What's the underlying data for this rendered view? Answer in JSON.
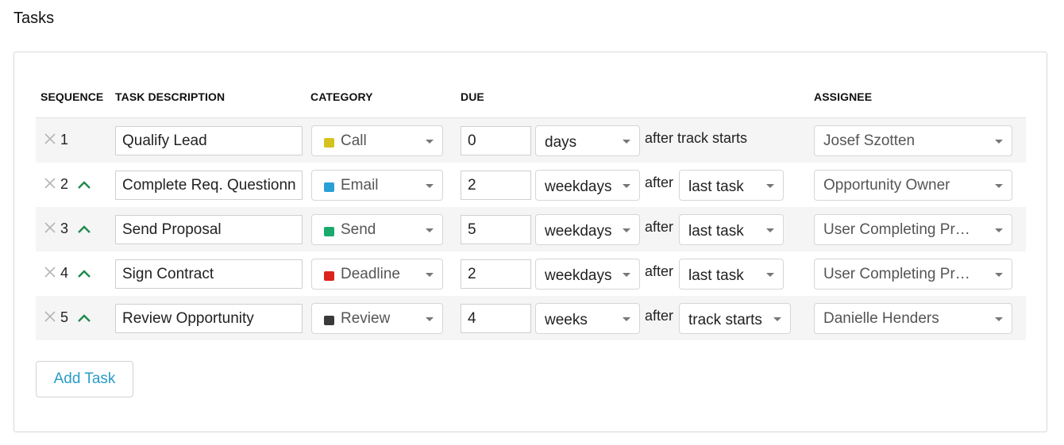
{
  "page": {
    "title": "Tasks"
  },
  "table": {
    "headers": {
      "sequence": "SEQUENCE",
      "description": "TASK DESCRIPTION",
      "category": "CATEGORY",
      "due": "DUE",
      "assignee": "ASSIGNEE"
    },
    "rows": [
      {
        "seq": "1",
        "description": "Qualify Lead",
        "category": "Call",
        "category_color": "#d4c31e",
        "due_amount": "0",
        "due_unit": "days",
        "after_label": "after track starts",
        "relative_to": null,
        "assignee": "Josef Szotten",
        "can_move_up": false
      },
      {
        "seq": "2",
        "description": "Complete Req. Questionnaire",
        "category": "Email",
        "category_color": "#2a9fd6",
        "due_amount": "2",
        "due_unit": "weekdays",
        "after_label": "after",
        "relative_to": "last task",
        "assignee": "Opportunity Owner",
        "can_move_up": true
      },
      {
        "seq": "3",
        "description": "Send Proposal",
        "category": "Send",
        "category_color": "#1aaa6e",
        "due_amount": "5",
        "due_unit": "weekdays",
        "after_label": "after",
        "relative_to": "last task",
        "assignee": "User Completing Pr…",
        "can_move_up": true
      },
      {
        "seq": "4",
        "description": "Sign Contract",
        "category": "Deadline",
        "category_color": "#d9251d",
        "due_amount": "2",
        "due_unit": "weekdays",
        "after_label": "after",
        "relative_to": "last task",
        "assignee": "User Completing Pr…",
        "can_move_up": true
      },
      {
        "seq": "5",
        "description": "Review Opportunity",
        "category": "Review",
        "category_color": "#3a3a3a",
        "due_amount": "4",
        "due_unit": "weeks",
        "after_label": "after",
        "relative_to": "track starts",
        "assignee": "Danielle Henders",
        "can_move_up": true
      }
    ]
  },
  "actions": {
    "add_task": "Add Task"
  },
  "icons": {
    "remove": "close-icon",
    "move_up": "chevron-up-icon",
    "dropdown": "caret-down-icon"
  },
  "colors": {
    "accent": "#2a9cc8",
    "move_up": "#1f8a4c",
    "row_alt": "#f5f5f5"
  }
}
